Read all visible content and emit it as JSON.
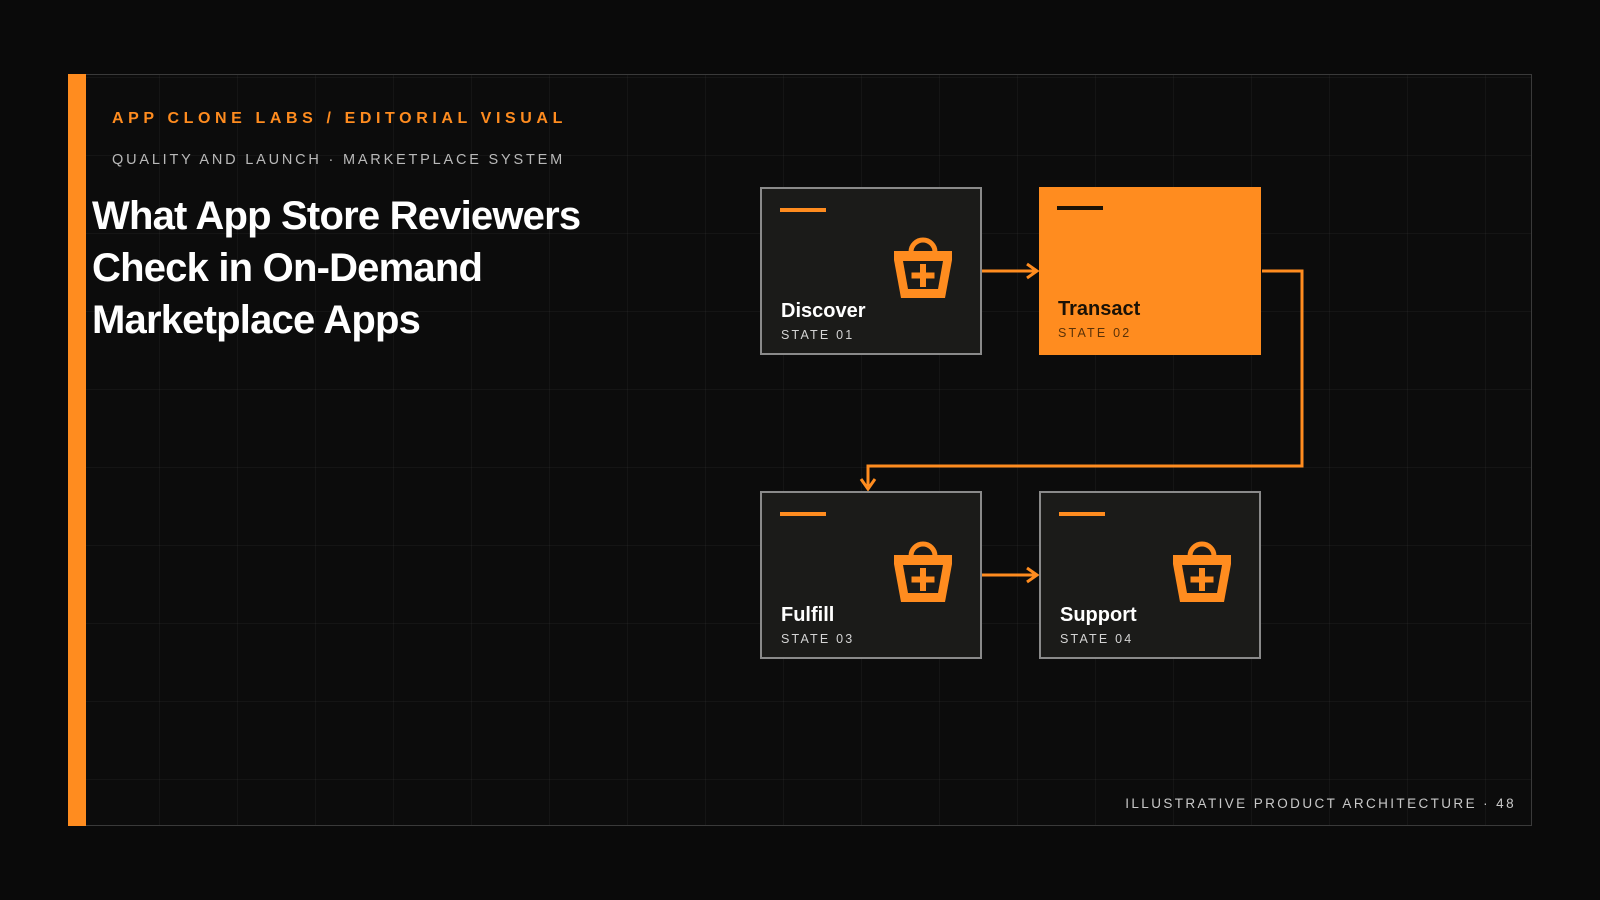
{
  "colors": {
    "accent": "#ff8c1f",
    "background": "#0a0a0a",
    "node_fill": "#1b1b19",
    "node_border": "#8a8a8a",
    "text": "#ffffff"
  },
  "header": {
    "eyebrow": "APP CLONE LABS / EDITORIAL VISUAL",
    "subhead": "QUALITY AND LAUNCH · MARKETPLACE SYSTEM"
  },
  "title": "What App Store Reviewers Check in On-Demand Marketplace Apps",
  "diagram": {
    "nodes": [
      {
        "label": "Discover",
        "state": "STATE 01",
        "icon": "shopping-basket-plus-icon",
        "highlighted": false
      },
      {
        "label": "Transact",
        "state": "STATE 02",
        "icon": "",
        "highlighted": true
      },
      {
        "label": "Fulfill",
        "state": "STATE 03",
        "icon": "shopping-basket-plus-icon",
        "highlighted": false
      },
      {
        "label": "Support",
        "state": "STATE 04",
        "icon": "shopping-basket-plus-icon",
        "highlighted": false
      }
    ],
    "edges": [
      {
        "from": "Discover",
        "to": "Transact"
      },
      {
        "from": "Transact",
        "to": "Fulfill"
      },
      {
        "from": "Fulfill",
        "to": "Support"
      }
    ]
  },
  "footer": "ILLUSTRATIVE PRODUCT ARCHITECTURE · 48"
}
